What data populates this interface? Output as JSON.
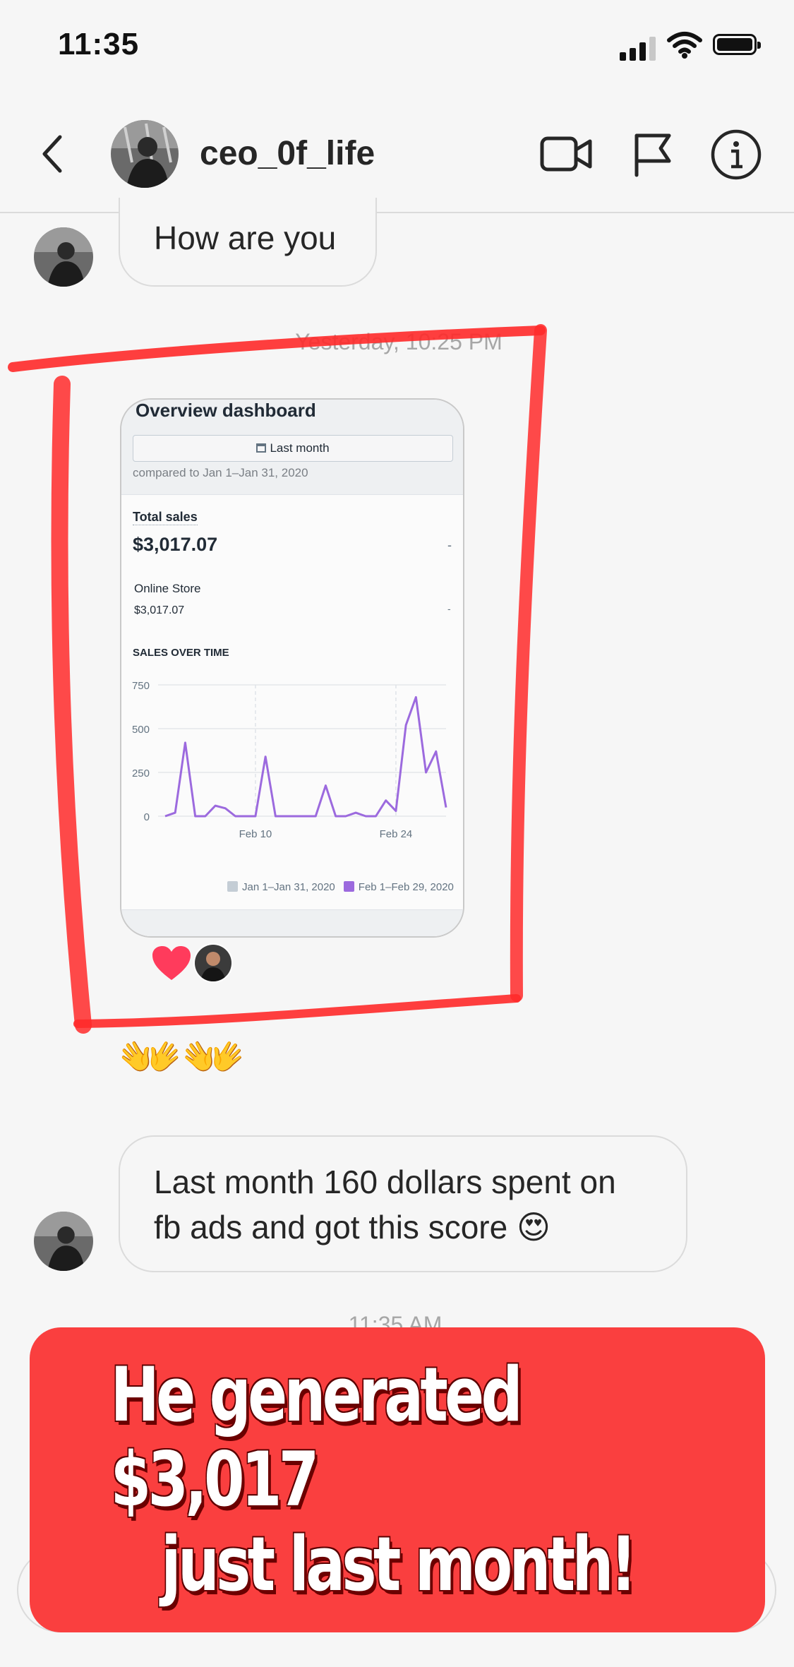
{
  "status_bar": {
    "time": "11:35"
  },
  "header": {
    "username": "ceo_0f_life"
  },
  "messages": {
    "msg1": "How are you",
    "timestamp1": "Yesterday, 10:25 PM",
    "reaction_emoji": "❤️",
    "claps": "👐",
    "msg2_line1": "Last month 160 dollars spent on",
    "msg2_line2": "fb ads and got this score 😍",
    "timestamp2": "11:35 AM"
  },
  "shared_screenshot": {
    "title": "Overview dashboard",
    "date_button": "Last month",
    "compare_text": "compared to Jan 1–Jan 31, 2020",
    "total_sales_label": "Total sales",
    "total_sales_value": "$3,017.07",
    "dash": "-",
    "online_store_label": "Online Store",
    "online_store_value": "$3,017.07",
    "chart_label": "SALES OVER TIME"
  },
  "chart_data": {
    "type": "line",
    "title": "SALES OVER TIME",
    "ylim": [
      0,
      750
    ],
    "y_ticks": [
      "750",
      "500",
      "250",
      "0"
    ],
    "x_tick_labels": [
      "Feb 10",
      "Feb 24"
    ],
    "x_tick_days": [
      10,
      24
    ],
    "series": [
      {
        "name": "Jan 1–Jan 31, 2020",
        "color": "#c4cdd5",
        "x": [],
        "values": []
      },
      {
        "name": "Feb 1–Feb 29, 2020",
        "color": "#9c6ade",
        "x": [
          1,
          2,
          3,
          4,
          5,
          6,
          7,
          8,
          9,
          10,
          11,
          12,
          13,
          14,
          15,
          16,
          17,
          18,
          19,
          20,
          21,
          22,
          23,
          24,
          25,
          26,
          27,
          28,
          29
        ],
        "values": [
          0,
          20,
          420,
          0,
          0,
          60,
          45,
          0,
          0,
          0,
          340,
          0,
          0,
          0,
          0,
          0,
          175,
          0,
          0,
          20,
          0,
          0,
          90,
          30,
          520,
          680,
          250,
          370,
          50
        ]
      }
    ],
    "legend_position": "bottom-right"
  },
  "banner": {
    "line1": "He generated $3,017",
    "line2": "just last month!"
  },
  "colors": {
    "banner_red": "#fa3f3f",
    "annotation_red": "#ff2a2a",
    "series_purple": "#9c6ade"
  }
}
